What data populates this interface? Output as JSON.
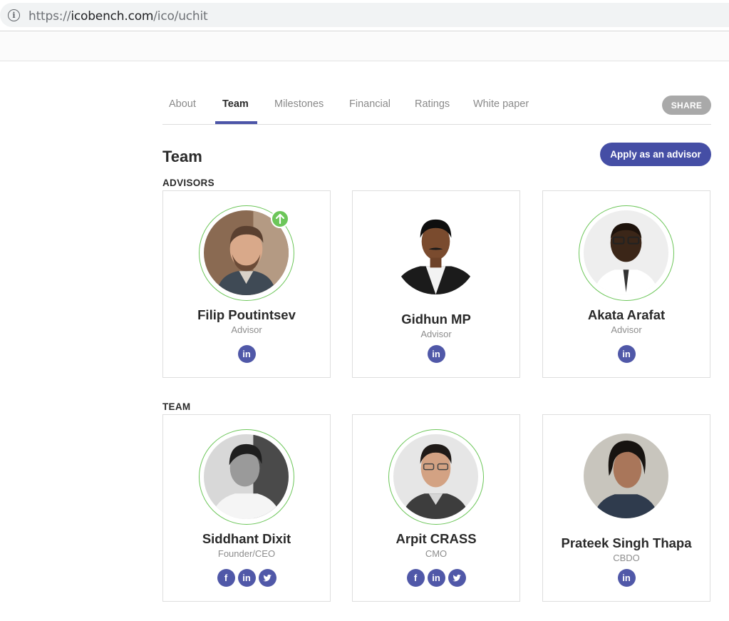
{
  "browser": {
    "url_scheme": "https://",
    "url_host": "icobench.com",
    "url_path": "/ico/uchit"
  },
  "tabs": [
    {
      "label": "About",
      "active": false
    },
    {
      "label": "Team",
      "active": true
    },
    {
      "label": "Milestones",
      "active": false
    },
    {
      "label": "Financial",
      "active": false
    },
    {
      "label": "Ratings",
      "active": false
    },
    {
      "label": "White paper",
      "active": false
    }
  ],
  "share_label": "SHARE",
  "section_title": "Team",
  "apply_label": "Apply as an advisor",
  "advisors_label": "ADVISORS",
  "team_label": "TEAM",
  "advisors": [
    {
      "name": "Filip Poutintsev",
      "role": "Advisor",
      "socials": [
        "linkedin"
      ],
      "verified": true
    },
    {
      "name": "Gidhun MP",
      "role": "Advisor",
      "socials": [
        "linkedin"
      ],
      "verified": false
    },
    {
      "name": "Akata Arafat",
      "role": "Advisor",
      "socials": [
        "linkedin"
      ],
      "verified": true
    }
  ],
  "team": [
    {
      "name": "Siddhant Dixit",
      "role": "Founder/CEO",
      "socials": [
        "facebook",
        "linkedin",
        "twitter"
      ],
      "verified": true
    },
    {
      "name": "Arpit CRASS",
      "role": "CMO",
      "socials": [
        "facebook",
        "linkedin",
        "twitter"
      ],
      "verified": true
    },
    {
      "name": "Prateek Singh Thapa",
      "role": "CBDO",
      "socials": [
        "linkedin"
      ],
      "verified": false
    }
  ],
  "colors": {
    "accent": "#454ea5",
    "verified_ring": "#6cc659",
    "share_bg": "#a9a9a9"
  }
}
